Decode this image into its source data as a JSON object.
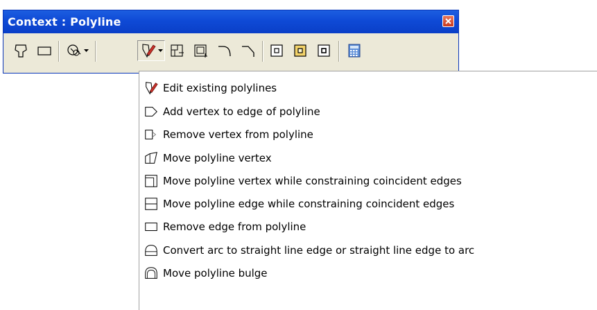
{
  "window": {
    "title": "Context : Polyline"
  },
  "toolbar": {
    "buttons": [
      {
        "icon": "polyline-shape-icon"
      },
      {
        "icon": "rectangle-icon"
      },
      {
        "icon": "circle-icon"
      },
      {
        "icon": "edit-polyline-icon",
        "active": true
      },
      {
        "icon": "constrain-vertex-icon"
      },
      {
        "icon": "constrain-edge-icon"
      },
      {
        "icon": "arc-corner-icon"
      },
      {
        "icon": "line-corner-icon"
      },
      {
        "icon": "vertex-square-icon"
      },
      {
        "icon": "vertex-square-highlight-icon"
      },
      {
        "icon": "vertex-square-alt-icon"
      },
      {
        "icon": "calculator-icon"
      }
    ]
  },
  "menu": {
    "items": [
      {
        "label": "Edit existing polylines",
        "icon": "edit-polyline-icon"
      },
      {
        "label": "Add vertex to edge of polyline",
        "icon": "add-vertex-icon"
      },
      {
        "label": "Remove vertex from polyline",
        "icon": "remove-vertex-icon"
      },
      {
        "label": "Move polyline vertex",
        "icon": "move-vertex-icon"
      },
      {
        "label": "Move polyline vertex while constraining coincident edges",
        "icon": "constrain-vertex-icon"
      },
      {
        "label": "Move polyline edge while constraining coincident edges",
        "icon": "constrain-edge-icon"
      },
      {
        "label": "Remove edge from polyline",
        "icon": "remove-edge-icon"
      },
      {
        "label": "Convert arc to straight line edge or straight line edge to arc",
        "icon": "convert-arc-icon"
      },
      {
        "label": "Move polyline bulge",
        "icon": "move-bulge-icon"
      }
    ]
  },
  "colors": {
    "titlebar": "#0f4ad6",
    "toolbar_bg": "#ece9d8",
    "close_button": "#d3492b",
    "pen_red": "#c8312a"
  }
}
